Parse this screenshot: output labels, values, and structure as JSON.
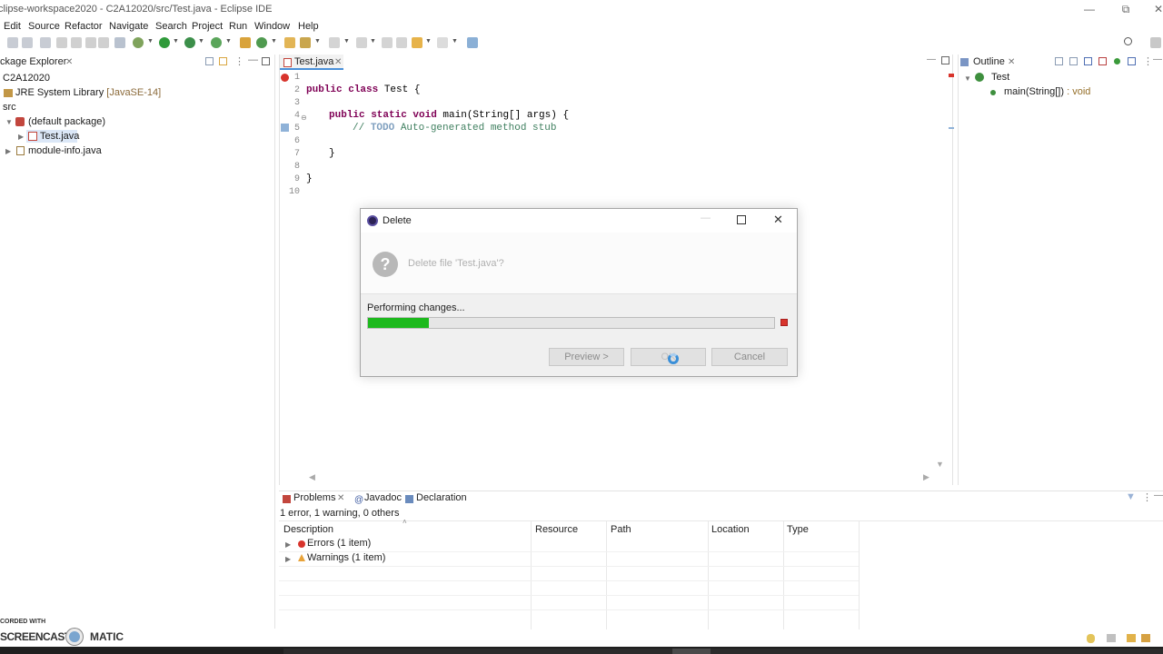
{
  "window": {
    "title": "clipse-workspace2020 - C2A12020/src/Test.java - Eclipse IDE"
  },
  "menu": [
    "Edit",
    "Source",
    "Refactor",
    "Navigate",
    "Search",
    "Project",
    "Run",
    "Window",
    "Help"
  ],
  "package_explorer": {
    "tab_label": "ckage Explorer",
    "project": "C2A12020",
    "jre": "JRE System Library",
    "jre_version": "[JavaSE-14]",
    "src": "src",
    "default_package": "(default package)",
    "test_file": "Test.java",
    "module_info": "module-info.java"
  },
  "editor": {
    "tab_label": "Test.java",
    "line_numbers": [
      "1",
      "2",
      "3",
      "4",
      "5",
      "6",
      "7",
      "8",
      "9",
      "10"
    ],
    "lines": {
      "l2_kw": "public class",
      "l2_rest": " Test {",
      "l4_kw": "public static void",
      "l4_rest": " main(String[] args) {",
      "l5_cmt_a": "// ",
      "l5_todo": "TODO",
      "l5_cmt_b": " Auto-generated method stub",
      "l7": "}",
      "l9": "}"
    }
  },
  "outline": {
    "tab_label": "Outline",
    "class_name": "Test",
    "method": "main(String[])",
    "method_type": " : void"
  },
  "problems": {
    "tabs": [
      "Problems",
      "Javadoc",
      "Declaration"
    ],
    "summary": "1 error, 1 warning, 0 others",
    "columns": [
      "Description",
      "Resource",
      "Path",
      "Location",
      "Type"
    ],
    "rows": [
      "Errors (1 item)",
      "Warnings (1 item)"
    ]
  },
  "dialog": {
    "title": "Delete",
    "message": "Delete file 'Test.java'?",
    "progress_label": "Performing changes...",
    "progress_fraction": 0.15,
    "buttons": {
      "preview": "Preview >",
      "ok": "OK",
      "cancel": "Cancel"
    }
  },
  "watermark": {
    "line1": "CORDED WITH",
    "line2_a": "SCREENCAST",
    "line2_b": "MATIC"
  },
  "colors": {
    "progress": "#1db91d",
    "keyword": "#7f0055",
    "comment": "#3f7f5f",
    "error": "#d8342c",
    "warning": "#e8a33a"
  }
}
